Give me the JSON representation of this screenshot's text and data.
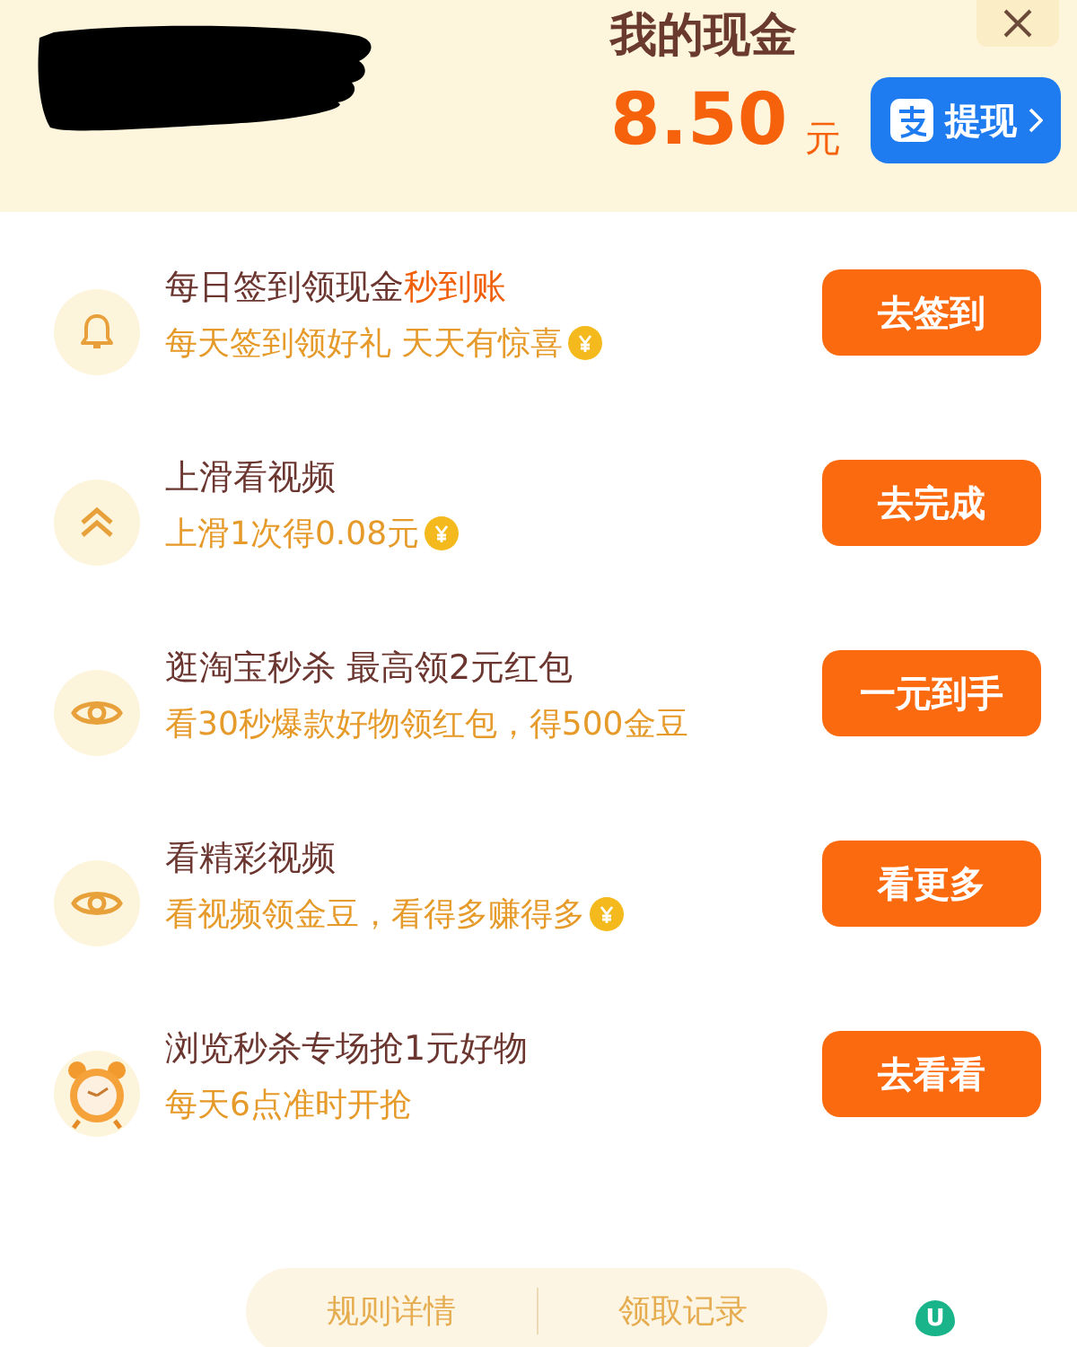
{
  "header": {
    "title": "我的现金",
    "amount": "8.50",
    "unit": "元",
    "withdraw_button": "提现"
  },
  "tasks": [
    {
      "kind": "bell",
      "title": "每日签到领现金**秒到账**",
      "subtitle": "每天签到领好礼 天天有惊喜",
      "coin": true,
      "button": "去签到"
    },
    {
      "kind": "chevrons",
      "title": "上滑看视频",
      "subtitle": "上滑1次得0.08元",
      "coin": true,
      "button": "去完成"
    },
    {
      "kind": "eye",
      "title": "逛淘宝秒杀 最高领2元红包",
      "subtitle": "看30秒爆款好物领红包，得500金豆",
      "coin": false,
      "button": "一元到手"
    },
    {
      "kind": "eye",
      "title": "看精彩视频",
      "subtitle": "看视频领金豆，看得多赚得多",
      "coin": true,
      "button": "看更多"
    },
    {
      "kind": "clock",
      "title": "浏览秒杀专场抢1元好物",
      "subtitle": "每天6点准时开抢",
      "coin": false,
      "button": "去看看"
    }
  ],
  "footer": {
    "links": [
      "规则详情",
      "领取记录"
    ],
    "badge": "U"
  }
}
